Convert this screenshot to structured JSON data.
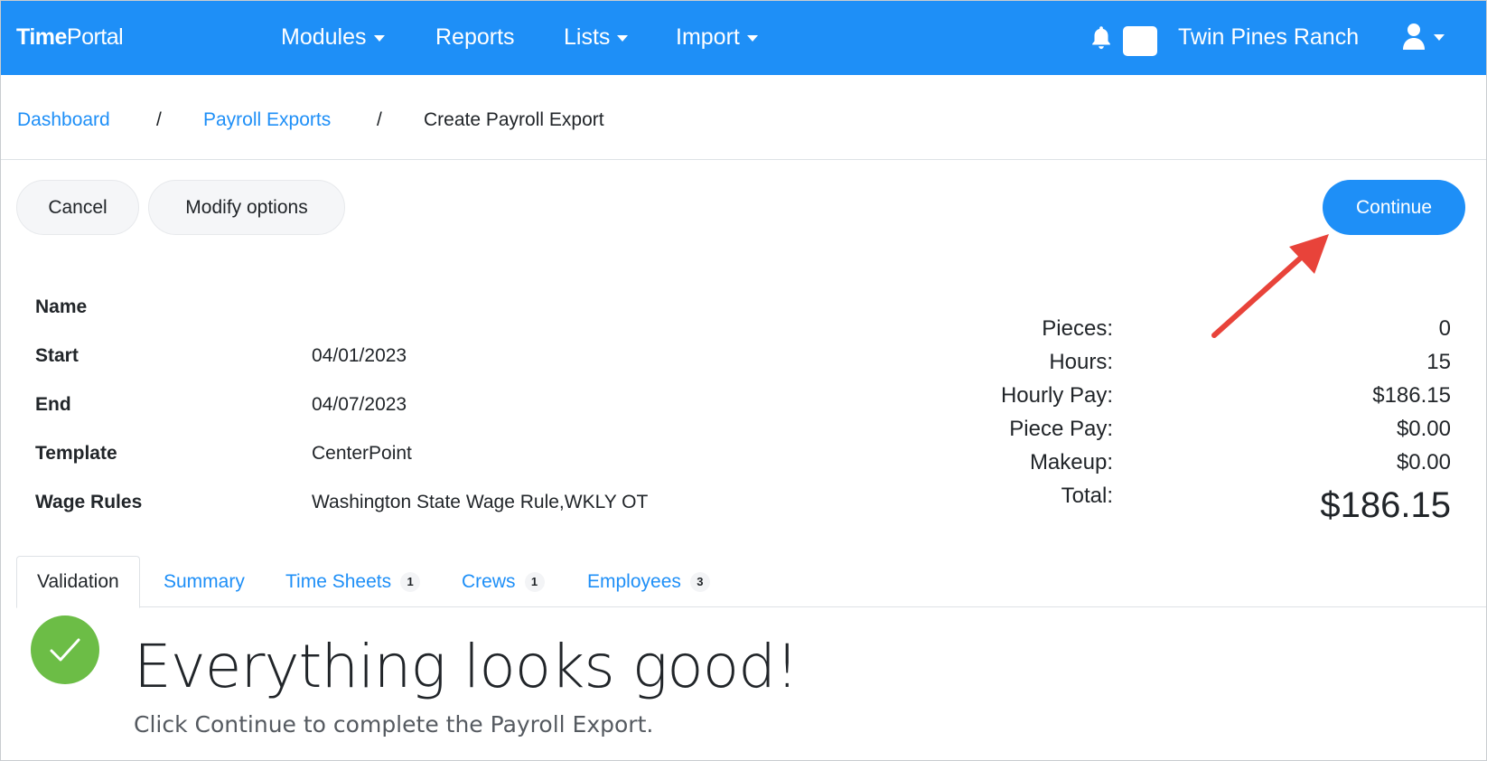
{
  "navbar": {
    "brand_bold": "Time",
    "brand_regular": "Portal",
    "items": [
      {
        "label": "Modules",
        "has_dropdown": true
      },
      {
        "label": "Reports",
        "has_dropdown": false
      },
      {
        "label": "Lists",
        "has_dropdown": true
      },
      {
        "label": "Import",
        "has_dropdown": true
      }
    ],
    "notification_icon": "bell-icon",
    "organization": "Twin Pines Ranch",
    "user_icon": "user-icon",
    "color": "#1e8ff7"
  },
  "breadcrumb": {
    "items": [
      {
        "label": "Dashboard"
      },
      {
        "label": "Payroll Exports"
      },
      {
        "label": "Create Payroll Export"
      }
    ],
    "separator": "/"
  },
  "actions": {
    "cancel_label": "Cancel",
    "modify_label": "Modify options",
    "continue_label": "Continue"
  },
  "details": [
    {
      "label": "Name",
      "value": ""
    },
    {
      "label": "Start",
      "value": "04/01/2023"
    },
    {
      "label": "End",
      "value": "04/07/2023"
    },
    {
      "label": "Template",
      "value": "CenterPoint"
    },
    {
      "label": "Wage Rules",
      "value": "Washington State Wage Rule,WKLY OT"
    }
  ],
  "totals": [
    {
      "label": "Pieces:",
      "value": "0"
    },
    {
      "label": "Hours:",
      "value": "15"
    },
    {
      "label": "Hourly Pay:",
      "value": "$186.15"
    },
    {
      "label": "Piece Pay:",
      "value": "$0.00"
    },
    {
      "label": "Makeup:",
      "value": "$0.00"
    },
    {
      "label": "Total:",
      "value": "$186.15"
    }
  ],
  "tabs": [
    {
      "label": "Validation",
      "badge": null,
      "active": true
    },
    {
      "label": "Summary",
      "badge": null,
      "active": false
    },
    {
      "label": "Time Sheets",
      "badge": "1",
      "active": false
    },
    {
      "label": "Crews",
      "badge": "1",
      "active": false
    },
    {
      "label": "Employees",
      "badge": "3",
      "active": false
    }
  ],
  "validation": {
    "icon": "check-circle-icon",
    "headline": "Everything looks good!",
    "message": "Click Continue to complete the Payroll Export.",
    "color": "#6cbd46"
  },
  "annotation": {
    "icon": "red-arrow-icon",
    "color": "#e8433a"
  }
}
